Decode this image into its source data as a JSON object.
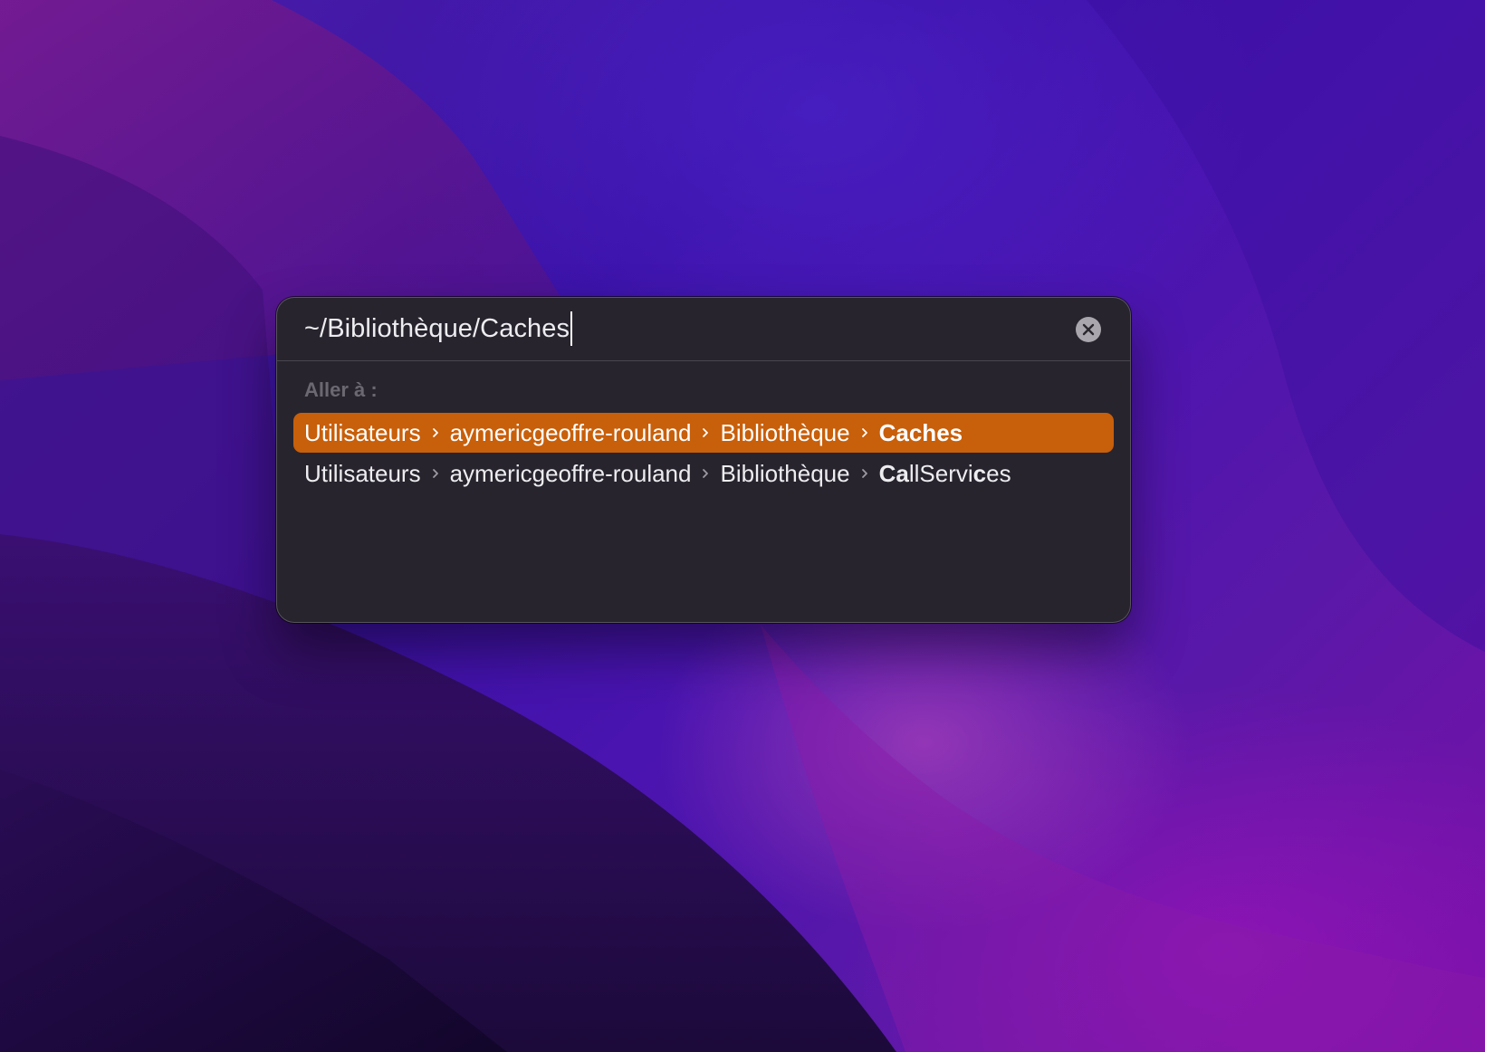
{
  "dialog": {
    "path_value": "~/Bibliothèque/Caches",
    "clear_icon": "xmark-circle-icon",
    "section_label": "Aller à :"
  },
  "results": [
    {
      "selected": true,
      "segments": [
        "Utilisateurs",
        "aymericgeoffre-rouland",
        "Bibliothèque"
      ],
      "last": "Caches"
    },
    {
      "selected": false,
      "segments": [
        "Utilisateurs",
        "aymericgeoffre-rouland",
        "Bibliothèque"
      ],
      "last_parts": [
        "Ca",
        "llServi",
        "c",
        "es"
      ]
    }
  ],
  "colors": {
    "highlight": "#c85f0a",
    "panel": "#28242e",
    "section_label": "#6c6872"
  }
}
